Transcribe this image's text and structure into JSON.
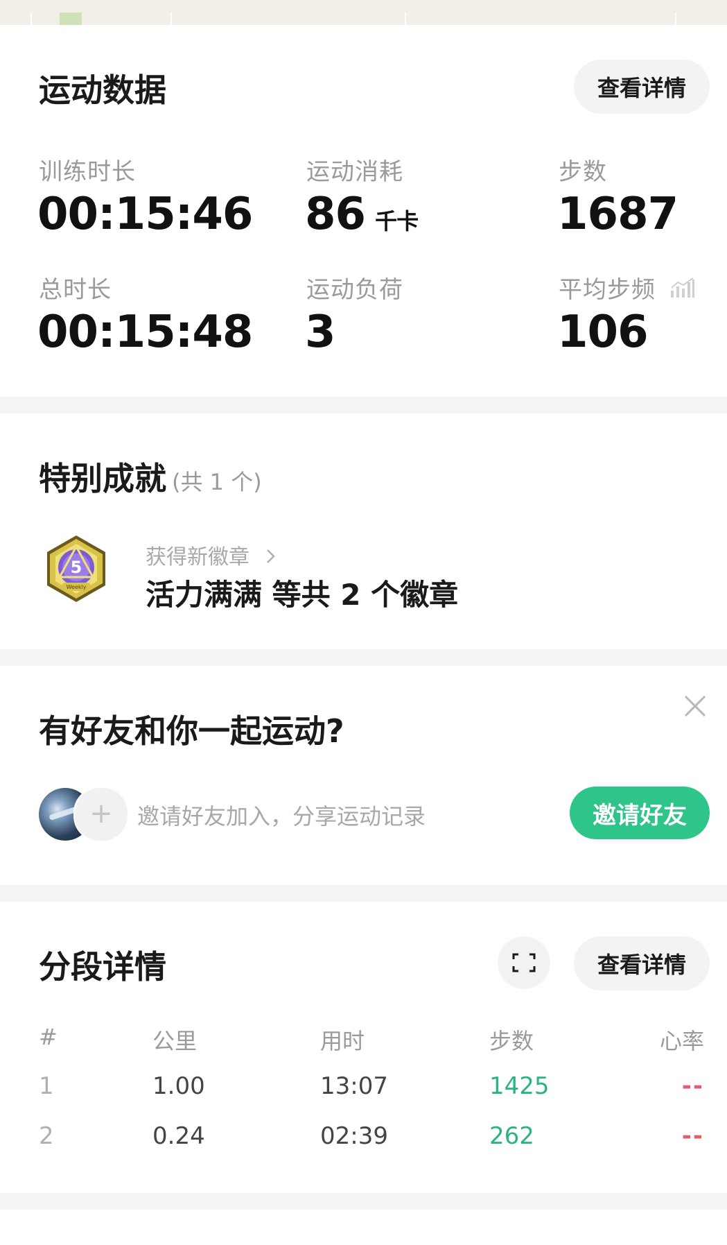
{
  "stats_card": {
    "title": "运动数据",
    "details_button": "查看详情",
    "items": [
      {
        "label": "训练时长",
        "value": "00:15:46",
        "unit": ""
      },
      {
        "label": "运动消耗",
        "value": "86",
        "unit": "千卡"
      },
      {
        "label": "步数",
        "value": "1687",
        "unit": ""
      },
      {
        "label": "总时长",
        "value": "00:15:48",
        "unit": ""
      },
      {
        "label": "运动负荷",
        "value": "3",
        "unit": ""
      },
      {
        "label": "平均步频",
        "value": "106",
        "unit": "",
        "icon": "trend-chart-icon"
      }
    ]
  },
  "achievements": {
    "title": "特别成就",
    "count_text": "(共 1 个)",
    "link_text": "获得新徽章",
    "main_text": "活力满满 等共 2 个徽章",
    "badge_icon": "weekly-badge-icon",
    "badge_text": "Weekly"
  },
  "friends": {
    "title": "有好友和你一起运动?",
    "hint": "邀请好友加入，分享运动记录",
    "invite_button": "邀请好友",
    "accent": "#2fc48a"
  },
  "splits": {
    "title": "分段详情",
    "details_button": "查看详情",
    "headers": {
      "idx": "#",
      "km": "公里",
      "time": "用时",
      "steps": "步数",
      "hr": "心率"
    },
    "rows": [
      {
        "idx": "1",
        "km": "1.00",
        "time": "13:07",
        "steps": "1425",
        "hr": "--"
      },
      {
        "idx": "2",
        "km": "0.24",
        "time": "02:39",
        "steps": "262",
        "hr": "--"
      }
    ],
    "steps_color": "#2bb57e",
    "hr_color": "#e35e6a"
  }
}
